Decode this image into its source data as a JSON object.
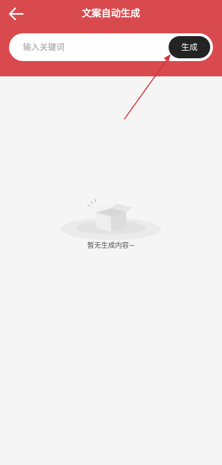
{
  "header": {
    "title": "文案自动生成",
    "back_icon": "arrow-left-icon"
  },
  "search": {
    "placeholder": "输入关键词",
    "value": "",
    "button_label": "生成"
  },
  "empty_state": {
    "icon": "empty-box-icon",
    "message": "暂无生成内容~"
  },
  "colors": {
    "header_bg": "#d94a4e",
    "button_bg": "#232323",
    "page_bg": "#f5f5f5"
  }
}
